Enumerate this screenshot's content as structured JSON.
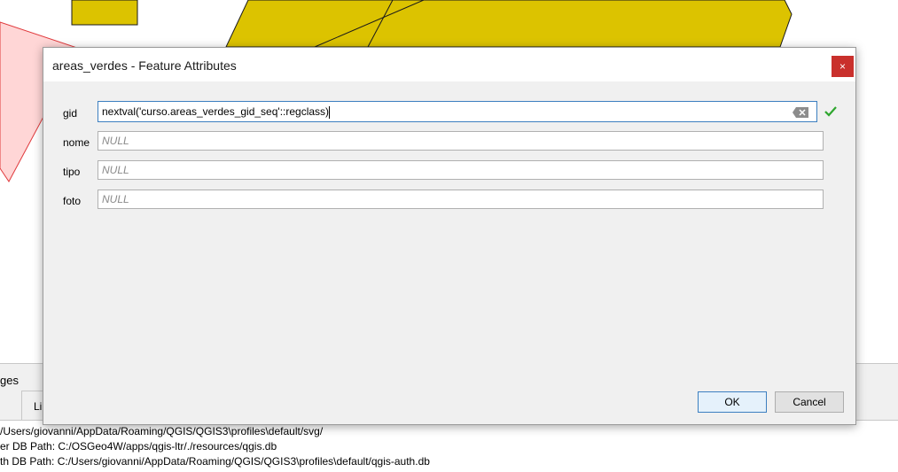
{
  "background": {
    "panel_title": "ges",
    "tab_label": "Li",
    "log_lines": [
      "/Users/giovanni/AppData/Roaming/QGIS/QGIS3\\profiles\\default/svg/",
      "er DB Path: C:/OSGeo4W/apps/qgis-ltr/./resources/qgis.db",
      "th DB Path: C:/Users/giovanni/AppData/Roaming/QGIS/QGIS3\\profiles\\default/qgis-auth.db"
    ],
    "map_colors": {
      "polygon_fill": "#dcc300",
      "polygon_stroke": "#1a1a1a",
      "selection_fill": "#ffd6d6",
      "selection_stroke": "#e0393c"
    }
  },
  "dialog": {
    "title": "areas_verdes - Feature Attributes",
    "close_label": "×",
    "fields": [
      {
        "label": "gid",
        "value": "nextval('curso.areas_verdes_gid_seq'::regclass)"
      },
      {
        "label": "nome",
        "placeholder": "NULL"
      },
      {
        "label": "tipo",
        "placeholder": "NULL"
      },
      {
        "label": "foto",
        "placeholder": "NULL"
      }
    ],
    "ok_label": "OK",
    "cancel_label": "Cancel",
    "icons": {
      "clear": "clear-text-icon",
      "valid": "checkmark-icon"
    },
    "accent_color": "#3c7fc0",
    "close_color": "#c9302c",
    "valid_color": "#2ea62e"
  }
}
